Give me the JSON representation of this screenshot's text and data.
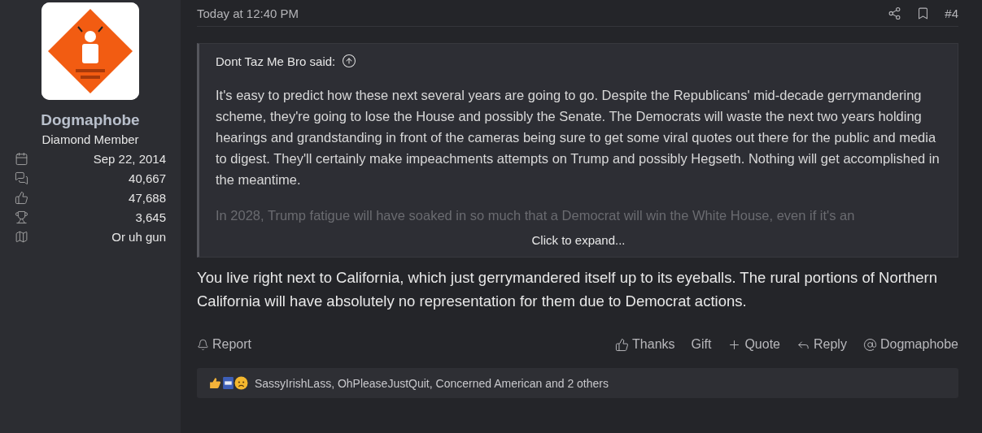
{
  "user": {
    "name": "Dogmaphobe",
    "title": "Diamond Member",
    "stats": [
      {
        "kind": "joined",
        "value": "Sep 22, 2014"
      },
      {
        "kind": "messages",
        "value": "40,667"
      },
      {
        "kind": "reactions",
        "value": "47,688"
      },
      {
        "kind": "points",
        "value": "3,645"
      },
      {
        "kind": "location",
        "value": "Or uh gun"
      }
    ]
  },
  "post": {
    "time": "Today at 12:40 PM",
    "number": "#4",
    "quote": {
      "author": "Dont Taz Me Bro said:",
      "paragraphs": [
        "It's easy to predict how these next several years are going to go. Despite the Republicans' mid-decade gerrymandering scheme, they're going to lose the House and possibly the Senate. The Democrats will waste the next two years holding hearings and grandstanding in front of the cameras being sure to get some viral quotes out there for the public and media to digest. They'll certainly make impeachments attempts on Trump and possibly Hegseth. Nothing will get accomplished in the meantime.",
        "In 2028, Trump fatigue will have soaked in so much that a Democrat will win the White House, even if it's an"
      ],
      "expand": "Click to expand..."
    },
    "body": "You live right next to California, which just gerrymandered itself up to its eyeballs. The rural portions of Northern California will have absolutely no representation for them due to Democrat actions.",
    "report": "Report",
    "actions": [
      {
        "kind": "thanks",
        "label": "Thanks"
      },
      {
        "kind": "gift",
        "label": "Gift"
      },
      {
        "kind": "quote",
        "label": "Quote"
      },
      {
        "kind": "reply",
        "label": "Reply"
      },
      {
        "kind": "mention",
        "label": "Dogmaphobe"
      }
    ],
    "reactions": {
      "text": "SassyIrishLass, OhPleaseJustQuit, Concerned American and 2 others"
    }
  }
}
